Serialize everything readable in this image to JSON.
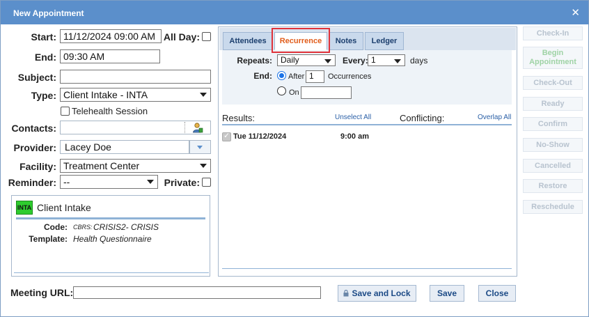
{
  "window": {
    "title": "New Appointment",
    "close": "✕"
  },
  "form": {
    "start_label": "Start:",
    "start_value": "11/12/2024 09:00 AM",
    "allday_label": "All Day:",
    "end_label": "End:",
    "end_value": "09:30 AM",
    "subject_label": "Subject:",
    "subject_value": "",
    "type_label": "Type:",
    "type_value": "Client Intake - INTA",
    "telehealth_label": "Telehealth Session",
    "contacts_label": "Contacts:",
    "contacts_value": "",
    "provider_label": "Provider:",
    "provider_value": "Lacey Doe",
    "facility_label": "Facility:",
    "facility_value": "Treatment Center",
    "reminder_label": "Reminder:",
    "reminder_value": "--",
    "private_label": "Private:"
  },
  "info": {
    "badge": "INTA",
    "title": "Client Intake",
    "code_label": "Code:",
    "code_prefix": "CBRS:",
    "code_value": "CRISIS2- CRISIS",
    "template_label": "Template:",
    "template_value": "Health Questionnaire",
    "badge_color": "#2ecc2e"
  },
  "tabs": [
    {
      "label": "Attendees",
      "active": false
    },
    {
      "label": "Recurrence",
      "active": true
    },
    {
      "label": "Notes",
      "active": false
    },
    {
      "label": "Ledger",
      "active": false
    }
  ],
  "recurrence": {
    "repeats_label": "Repeats:",
    "repeats_value": "Daily",
    "every_label": "Every:",
    "every_value": "1",
    "every_unit": "days",
    "end_label": "End:",
    "after_label": "After",
    "after_value": "1",
    "occurrences_label": "Occurrences",
    "on_label": "On",
    "on_value": ""
  },
  "results": {
    "results_label": "Results:",
    "unselect_all": "Unselect All",
    "conflicting_label": "Conflicting:",
    "overlap_all": "Overlap All",
    "rows": [
      {
        "date": "Tue 11/12/2024",
        "time": "9:00 am"
      }
    ]
  },
  "side_buttons": [
    "Check-In",
    "Begin Appointment",
    "Check-Out",
    "Ready",
    "Confirm",
    "No-Show",
    "Cancelled",
    "Restore",
    "Reschedule"
  ],
  "footer": {
    "meeting_url_label": "Meeting URL:",
    "meeting_url_value": "",
    "save_lock": "Save and Lock",
    "save": "Save",
    "close": "Close"
  },
  "colors": {
    "titlebar": "#5b8fcb",
    "active_tab_text": "#e15d1b",
    "highlight": "#e0323a"
  }
}
